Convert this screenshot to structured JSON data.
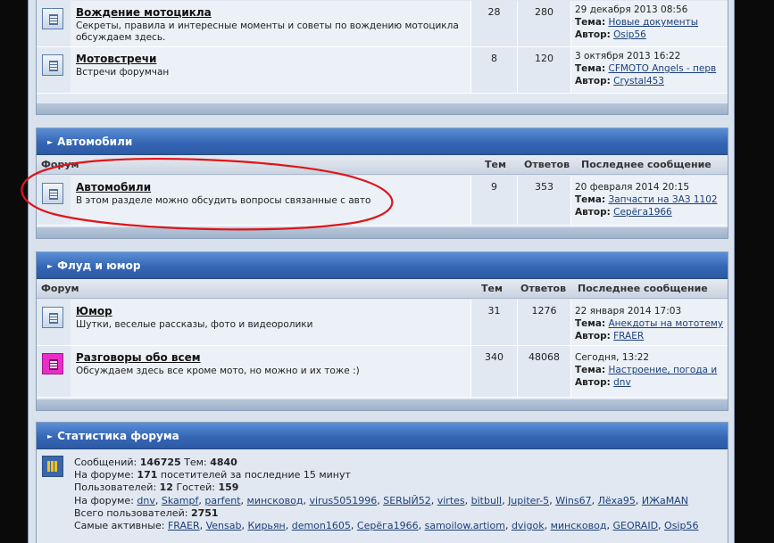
{
  "sections": [
    {
      "title": "",
      "forums": [
        {
          "title": "Вождение мотоцикла",
          "desc": "Секреты, правила и интересные моменты и советы по вождению мотоцикла обсуждаем здесь.",
          "topics": "28",
          "posts": "280",
          "date": "29 декабря 2013 08:56",
          "topic_label": "Тема:",
          "topic": "Новые документы",
          "author_label": "Автор:",
          "author": "Osip56"
        },
        {
          "title": "Мотовстречи",
          "desc": "Встречи форумчан",
          "topics": "8",
          "posts": "120",
          "date": "3 октября 2013 16:22",
          "topic_label": "Тема:",
          "topic": "CFMOTO Angels - перв",
          "author_label": "Автор:",
          "author": "Crystal453"
        }
      ]
    },
    {
      "title": "Автомобили",
      "columns": {
        "forum": "Форум",
        "topics": "Тем",
        "posts": "Ответов",
        "last": "Последнее сообщение"
      },
      "forums": [
        {
          "title": "Автомобили",
          "desc": "В этом разделе можно обсудить вопросы связанные с авто",
          "topics": "9",
          "posts": "353",
          "date": "20 февраля 2014 20:15",
          "topic_label": "Тема:",
          "topic": "Запчасти на ЗАЗ 1102",
          "author_label": "Автор:",
          "author": "Серёга1966"
        }
      ]
    },
    {
      "title": "Флуд и юмор",
      "columns": {
        "forum": "Форум",
        "topics": "Тем",
        "posts": "Ответов",
        "last": "Последнее сообщение"
      },
      "forums": [
        {
          "title": "Юмор",
          "desc": "Шутки, веселые рассказы, фото и видеоролики",
          "topics": "31",
          "posts": "1276",
          "date": "22 января 2014 17:03",
          "topic_label": "Тема:",
          "topic": "Анекдоты на мототему",
          "author_label": "Автор:",
          "author": "FRAER"
        },
        {
          "title": "Разговоры обо всем",
          "desc": "Обсуждаем здесь все кроме мото, но можно и их тоже :)",
          "topics": "340",
          "posts": "48068",
          "date": "Сегодня, 13:22",
          "topic_label": "Тема:",
          "topic": "Настроение, погода и",
          "author_label": "Автор:",
          "author": "dnv"
        }
      ]
    }
  ],
  "stats": {
    "title": "Статистика форума",
    "posts_label": "Сообщений:",
    "posts": "146725",
    "topics_label": "Тем:",
    "topics": "4840",
    "online_prefix": "На форуме:",
    "online": "171",
    "online_suffix": "посетителей за последние 15 минут",
    "users_label": "Пользователей:",
    "users": "12",
    "guests_label": "Гостей:",
    "guests": "159",
    "on_forum_label": "На форуме:",
    "on_forum": [
      "dnv",
      "Skampf",
      "parfent",
      "минсковод",
      "virus5051996",
      "SERЫЙ52",
      "virtes",
      "bitbull",
      "Jupiter-5",
      "Wins67",
      "Лёха95",
      "ИЖаMAN"
    ],
    "total_label": "Всего пользователей:",
    "total": "2751",
    "active_label": "Самые активные:",
    "active": [
      "FRAER",
      "Vensab",
      "Кирьян",
      "demon1605",
      "Серёга1966",
      "samoilow.artiom",
      "dvigok",
      "минсковод",
      "GEORAID",
      "Osip56"
    ]
  }
}
